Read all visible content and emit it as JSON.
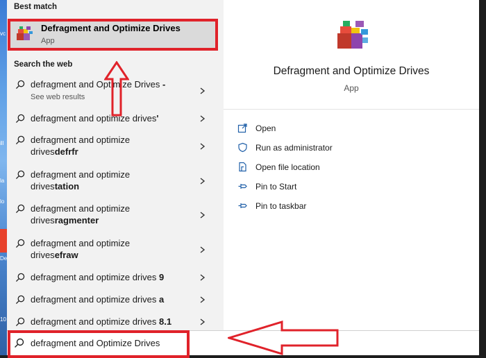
{
  "desktop": {
    "strip_marks": [
      "vc",
      "ill",
      "la",
      "lo",
      "De",
      "10"
    ]
  },
  "left_pane": {
    "best_match_label": "Best match",
    "best_match": {
      "title": "Defragment and Optimize Drives",
      "subtitle": "App"
    },
    "search_web_label": "Search the web",
    "web_results": [
      {
        "line1": "defragment and Optimize Drives",
        "line1_bold": " -",
        "line2": "",
        "line2_bold": "",
        "sub": "See web results"
      },
      {
        "line1": "defragment and optimize drives",
        "line1_bold": "'",
        "line2": "",
        "line2_bold": "",
        "sub": ""
      },
      {
        "line1": "defragment and optimize",
        "line1_bold": "",
        "line2": "drives",
        "line2_bold": "defrfr",
        "sub": ""
      },
      {
        "line1": "defragment and optimize",
        "line1_bold": "",
        "line2": "drives",
        "line2_bold": "tation",
        "sub": ""
      },
      {
        "line1": "defragment and optimize",
        "line1_bold": "",
        "line2": "drives",
        "line2_bold": "ragmenter",
        "sub": ""
      },
      {
        "line1": "defragment and optimize",
        "line1_bold": "",
        "line2": "drives",
        "line2_bold": "efraw",
        "sub": ""
      },
      {
        "line1": "defragment and optimize drives ",
        "line1_bold": "9",
        "line2": "",
        "line2_bold": "",
        "sub": ""
      },
      {
        "line1": "defragment and optimize drives ",
        "line1_bold": "a",
        "line2": "",
        "line2_bold": "",
        "sub": ""
      },
      {
        "line1": "defragment and optimize drives ",
        "line1_bold": "8.1",
        "line2": "",
        "line2_bold": "",
        "sub": ""
      }
    ]
  },
  "right_pane": {
    "title": "Defragment and Optimize Drives",
    "subtitle": "App",
    "actions": [
      {
        "label": "Open",
        "icon": "open-icon",
        "selected": true
      },
      {
        "label": "Run as administrator",
        "icon": "shield-icon",
        "selected": false
      },
      {
        "label": "Open file location",
        "icon": "file-location-icon",
        "selected": false
      },
      {
        "label": "Pin to Start",
        "icon": "pin-icon",
        "selected": false
      },
      {
        "label": "Pin to taskbar",
        "icon": "pin-icon",
        "selected": false
      }
    ]
  },
  "search_bar": {
    "value": "defragment and Optimize Drives"
  },
  "colors": {
    "annotation_red": "#e0222a",
    "selected_action_bg": "#cbe3f5",
    "best_match_bg": "#dadada"
  }
}
